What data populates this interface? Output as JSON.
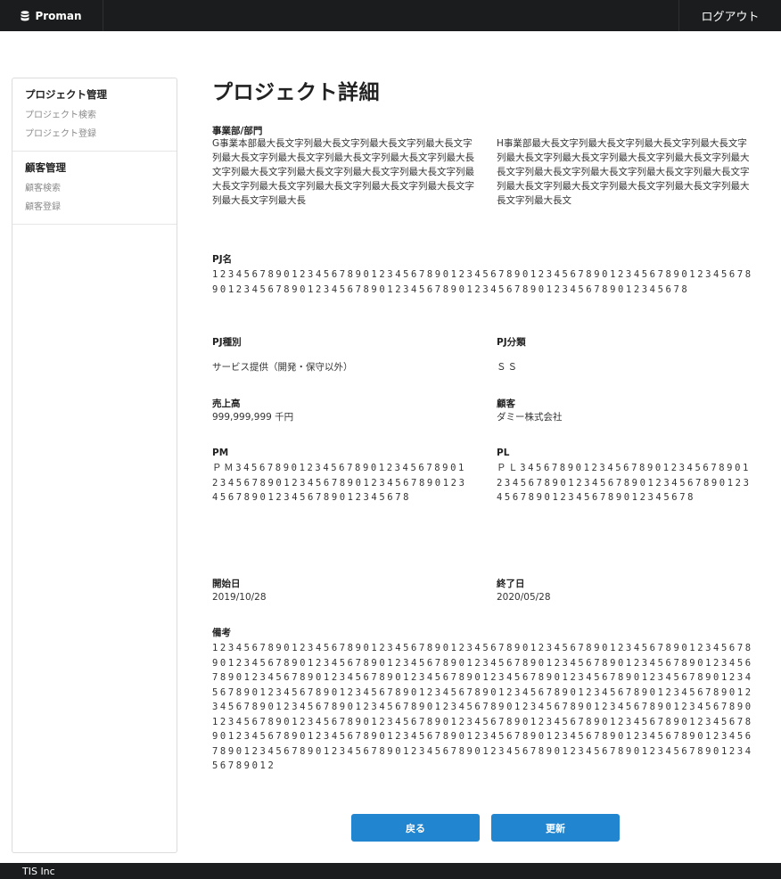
{
  "header": {
    "brand": "Proman",
    "logout": "ログアウト"
  },
  "sidebar": {
    "groups": [
      {
        "title": "プロジェクト管理",
        "items": [
          "プロジェクト検索",
          "プロジェクト登録"
        ]
      },
      {
        "title": "顧客管理",
        "items": [
          "顧客検索",
          "顧客登録"
        ]
      }
    ]
  },
  "main": {
    "title": "プロジェクト詳細",
    "division": {
      "label": "事業部/部門",
      "left": "G事業本部最大長文字列最大長文字列最大長文字列最大長文字列最大長文字列最大長文字列最大長文字列最大長文字列最大長文字列最大長文字列最大長文字列最大長文字列最大長文字列最大長文字列最大長文字列最大長文字列最大長文字列最大長文字列最大長文字列最大長",
      "right": "H事業部最大長文字列最大長文字列最大長文字列最大長文字列最大長文字列最大長文字列最大長文字列最大長文字列最大長文字列最大長文字列最大長文字列最大長文字列最大長文字列最大長文字列最大長文字列最大長文字列最大長文字列最大長文字列最大長文"
    },
    "pj_name": {
      "label": "PJ名",
      "value": "12345678901234567890123456789012345678901234567890123456789012345678901234567890123456789012345678901234567890123456789012345678"
    },
    "pj_type": {
      "label": "PJ種別",
      "value": "サービス提供（開発・保守以外）"
    },
    "pj_class": {
      "label": "PJ分類",
      "value": "ＳＳ"
    },
    "sales": {
      "label": "売上高",
      "value": "999,999,999 千円"
    },
    "client": {
      "label": "顧客",
      "value": "ダミー株式会社"
    },
    "pm": {
      "label": "PM",
      "value": "ＰＭ34567890123456789012345678901234567890123456789012345678901234567890123456789012345678"
    },
    "pl": {
      "label": "PL",
      "value": "ＰＬ34567890123456789012345678901234567890123456789012345678901234567890123456789012345678"
    },
    "start": {
      "label": "開始日",
      "value": "2019/10/28"
    },
    "end": {
      "label": "終了日",
      "value": "2020/05/28"
    },
    "note": {
      "label": "備考",
      "value": "123456789012345678901234567890123456789012345678901234567890123456789012345678901234567890123456789012345678901234567890123456789012345678901234567890123456789012345678901234567890123456789012345678901234567890123456789012345678901234567890123456789012345678901234567890123456789012345678901234567890123456789012345678901234567890123456789012345678901234567890123456789012345678901234567890123456789012345678901234567890123456789012345678901234567890123456789012345678901234567890123456789012345678901234567890123456789012345678901234567890123456789012"
    },
    "buttons": {
      "back": "戻る",
      "update": "更新"
    }
  },
  "footer": {
    "text": "TIS Inc"
  }
}
